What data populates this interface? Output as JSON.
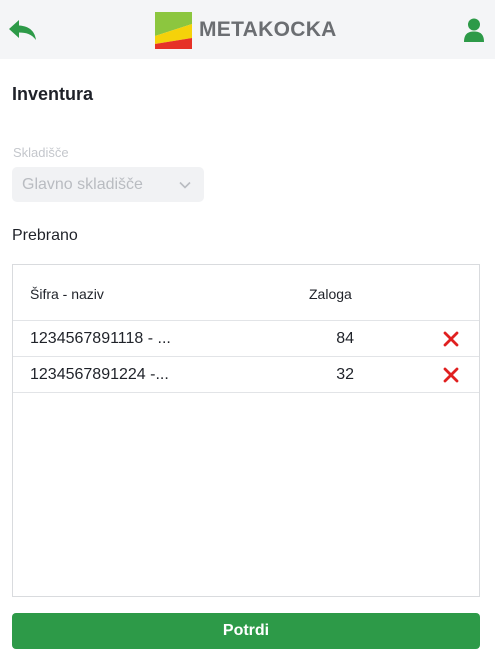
{
  "header": {
    "back_icon": "back-arrow-icon",
    "brand": "METAKOCKA",
    "user_icon": "user-icon",
    "accent": "#2d9a48"
  },
  "page": {
    "title": "Inventura"
  },
  "warehouse": {
    "label": "Skladišče",
    "selected": "Glavno skladišče"
  },
  "counted": {
    "label": "Prebrano",
    "columns": {
      "code": "Šifra - naziv",
      "stock": "Zaloga"
    },
    "rows": [
      {
        "code": "1234567891118 - ...",
        "stock": "84"
      },
      {
        "code": "1234567891224 -...",
        "stock": "32"
      }
    ]
  },
  "actions": {
    "confirm": "Potrdi"
  }
}
